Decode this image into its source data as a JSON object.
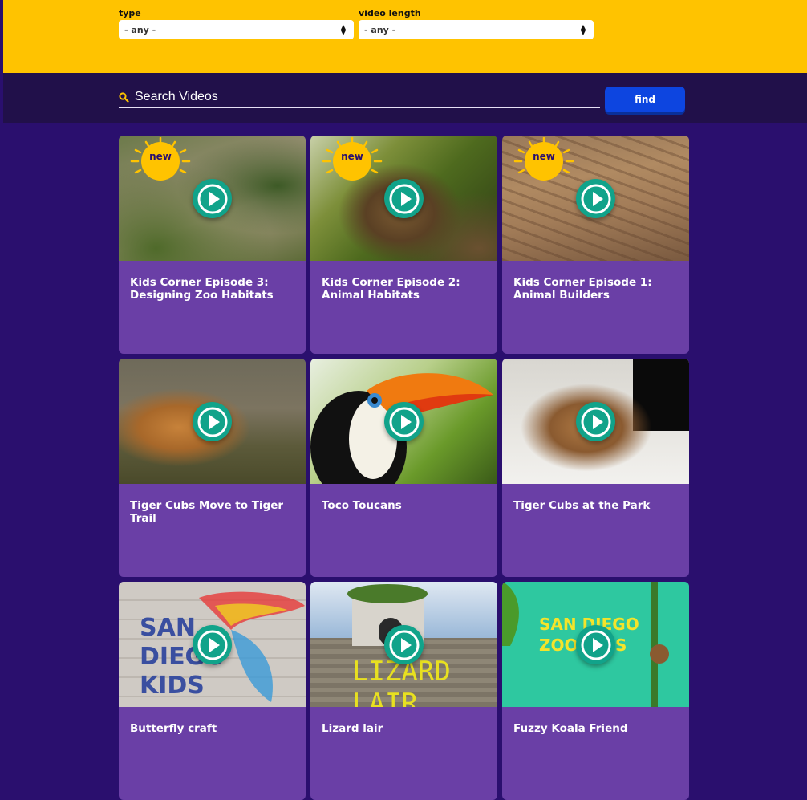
{
  "filters": {
    "type": {
      "label": "type",
      "value": "- any -"
    },
    "video_length": {
      "label": "video length",
      "value": "- any -"
    }
  },
  "search": {
    "placeholder": "Search Videos",
    "value": "",
    "button_label": "find"
  },
  "badge_text": "new",
  "videos": [
    {
      "title": "Kids Corner Episode 3: Designing Zoo Habitats",
      "is_new": true
    },
    {
      "title": "Kids Corner Episode 2: Animal Habitats",
      "is_new": true
    },
    {
      "title": "Kids Corner Episode 1: Animal Builders",
      "is_new": true
    },
    {
      "title": "Tiger Cubs Move to Tiger Trail",
      "is_new": false
    },
    {
      "title": "Toco Toucans",
      "is_new": false
    },
    {
      "title": "Tiger Cubs at the Park",
      "is_new": false
    },
    {
      "title": "Butterfly craft",
      "is_new": false,
      "thumb_text": "SAN DIEGO KIDS"
    },
    {
      "title": "Lizard lair",
      "is_new": false,
      "thumb_text": "LIZARD LAIR"
    },
    {
      "title": "Fuzzy Koala Friend",
      "is_new": false,
      "thumb_text": "SAN DIEGO ZOO KIDS"
    }
  ],
  "colors": {
    "filter_bar": "#ffc300",
    "search_bar": "#21104a",
    "page_bg": "#2a0f6e",
    "card": "#6a3fa6",
    "find_button": "#0d45e0",
    "play_button": "#11a38a",
    "badge": "#ffc300"
  },
  "icons": {
    "search": "search-icon",
    "play": "play-icon",
    "select_arrows": "updown-arrows-icon"
  }
}
